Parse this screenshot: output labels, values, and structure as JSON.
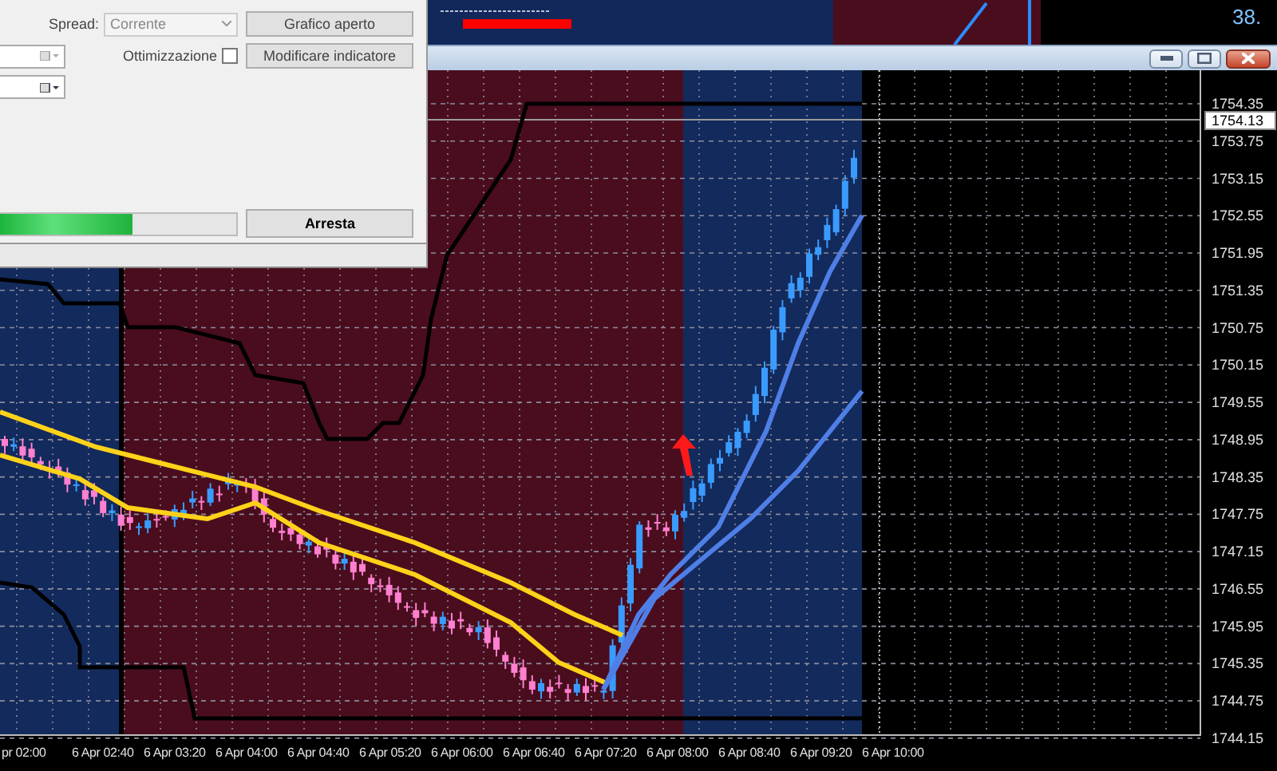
{
  "background_window": {
    "reading": "38."
  },
  "tester": {
    "spread_label": "Spread:",
    "spread_value": "Corrente",
    "open_chart_button": "Grafico aperto",
    "optimization": {
      "label": "Ottimizzazione",
      "checked": false
    },
    "modify_indicator_button": "Modificare indicatore",
    "progress": {
      "level": 0.56
    },
    "stop_button": "Arresta"
  },
  "chart": {
    "price_labels": [
      "1754.35",
      "1753.75",
      "1753.15",
      "1752.55",
      "1751.95",
      "1751.35",
      "1750.75",
      "1750.15",
      "1749.55",
      "1748.95",
      "1748.35",
      "1747.75",
      "1747.15",
      "1746.55",
      "1745.95",
      "1745.35",
      "1744.75",
      "1744.15"
    ],
    "current_price": "1754.13",
    "time_labels": [
      "pr 02:00",
      "6 Apr 02:40",
      "6 Apr 03:20",
      "6 Apr 04:00",
      "6 Apr 04:40",
      "6 Apr 05:20",
      "6 Apr 06:00",
      "6 Apr 06:40",
      "6 Apr 07:20",
      "6 Apr 08:00",
      "6 Apr 08:40",
      "6 Apr 09:20",
      "6 Apr 10:00"
    ]
  }
}
